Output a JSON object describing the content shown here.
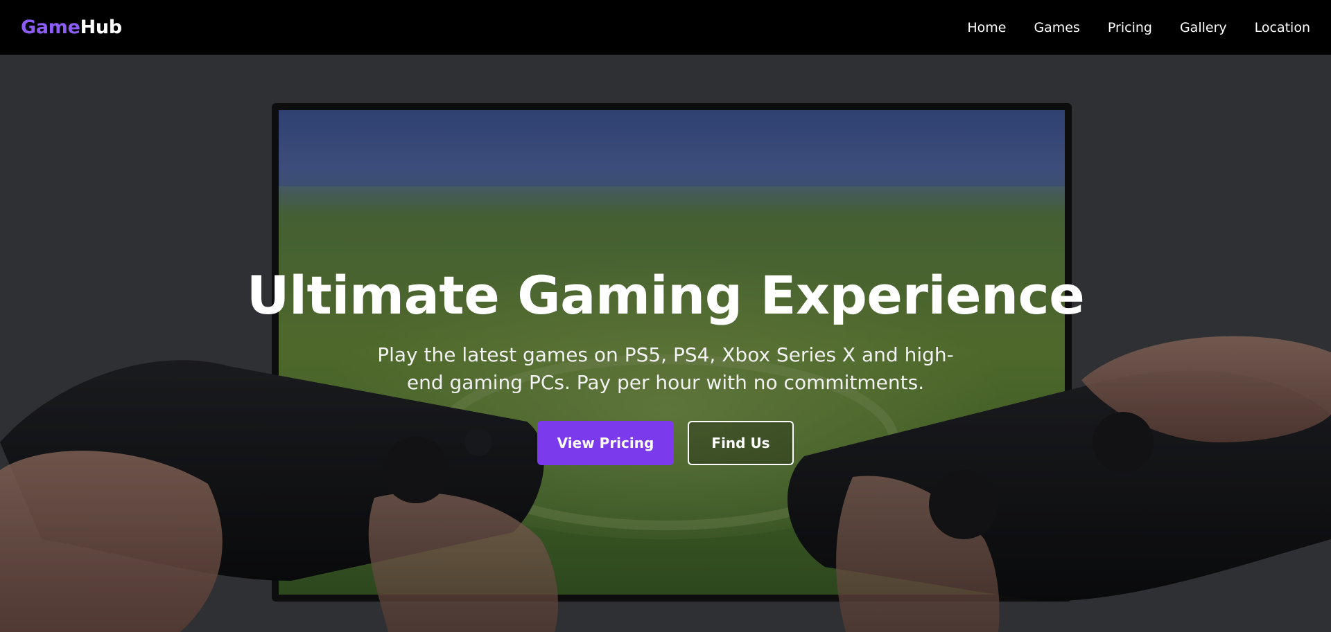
{
  "brand": {
    "name_part_1": "Game",
    "name_part_2": "Hub",
    "accent_color": "#8b5cf6"
  },
  "nav": {
    "items": [
      {
        "label": "Home"
      },
      {
        "label": "Games"
      },
      {
        "label": "Pricing"
      },
      {
        "label": "Gallery"
      },
      {
        "label": "Location"
      }
    ]
  },
  "hero": {
    "title": "Ultimate Gaming Experience",
    "subtitle": "Play the latest games on PS5, PS4, Xbox Series X and high-end gaming PCs. Pay per hour with no commitments.",
    "primary_button": "View Pricing",
    "secondary_button": "Find Us",
    "primary_color": "#7c3aed"
  }
}
